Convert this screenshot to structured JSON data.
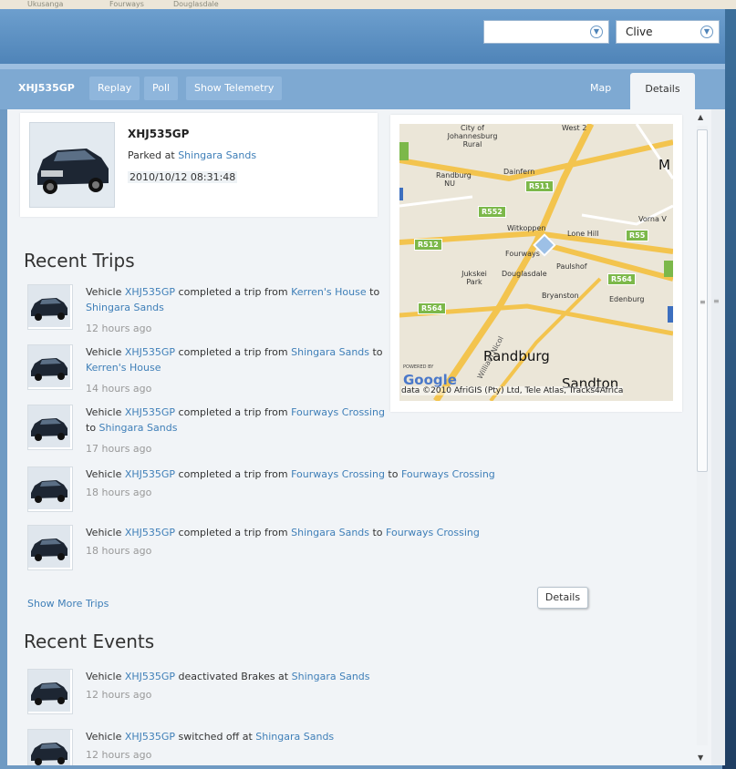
{
  "background": {
    "map_labels": [
      "Ukusanga",
      "Fourways",
      "Douglasdale"
    ]
  },
  "header": {
    "select_1": {
      "value": ""
    },
    "select_2": {
      "value": "Clive"
    }
  },
  "toolbar": {
    "vehicle_id": "XHJ535GP",
    "buttons": [
      "Replay",
      "Poll",
      "Show Telemetry"
    ],
    "tabs": [
      "Map",
      "Details"
    ],
    "active_tab": "Details"
  },
  "vehicle": {
    "id": "XHJ535GP",
    "status_prefix": "Parked at ",
    "location": "Shingara Sands",
    "timestamp": "2010/10/12 08:31:48"
  },
  "map": {
    "labels": [
      "City of Johannesburg Rural",
      "West 2",
      "Randburg NU",
      "Dainfern",
      "Witkoppen",
      "Lone Hill",
      "Vorna V",
      "Fourways",
      "Jukskei Park",
      "Douglasdale",
      "Paulshof",
      "Bryanston",
      "Edenburg",
      "M"
    ],
    "big_labels": [
      "Randburg",
      "Sandton"
    ],
    "shields": [
      "R511",
      "R552",
      "R512",
      "R564",
      "R564",
      "R55"
    ],
    "road_name": "William Nicol",
    "powered_by": "POWERED BY",
    "logo": "Google",
    "attribution": "data ©2010 AfriGIS (Pty) Ltd, Tele Atlas, Tracks4Africa"
  },
  "recent_trips": {
    "title": "Recent Trips",
    "items": [
      {
        "prefix": "Vehicle ",
        "vehicle": "XHJ535GP",
        "middle": " completed a trip from ",
        "from": "Kerren's House",
        "to_word": " to ",
        "to": "Shingara Sands",
        "time": "12 hours ago"
      },
      {
        "prefix": "Vehicle ",
        "vehicle": "XHJ535GP",
        "middle": " completed a trip from ",
        "from": "Shingara Sands",
        "to_word": " to ",
        "to": "Kerren's House",
        "time": "14 hours ago"
      },
      {
        "prefix": "Vehicle ",
        "vehicle": "XHJ535GP",
        "middle": " completed a trip from ",
        "from": "Fourways Crossing",
        "to_word": " to ",
        "to": "Shingara Sands",
        "time": "17 hours ago"
      },
      {
        "prefix": "Vehicle ",
        "vehicle": "XHJ535GP",
        "middle": " completed a trip from ",
        "from": "Fourways Crossing",
        "to_word": " to ",
        "to": "Fourways Crossing",
        "time": "18 hours ago"
      },
      {
        "prefix": "Vehicle ",
        "vehicle": "XHJ535GP",
        "middle": " completed a trip from ",
        "from": "Shingara Sands",
        "to_word": " to ",
        "to": "Fourways Crossing",
        "time": "18 hours ago"
      }
    ],
    "show_more": "Show More Trips"
  },
  "details_button": "Details",
  "recent_events": {
    "title": "Recent Events",
    "items": [
      {
        "prefix": "Vehicle ",
        "vehicle": "XHJ535GP",
        "action": " deactivated Brakes at ",
        "place": "Shingara Sands",
        "time": "12 hours ago"
      },
      {
        "prefix": "Vehicle ",
        "vehicle": "XHJ535GP",
        "action": " switched off at ",
        "place": "Shingara Sands",
        "time": "12 hours ago"
      }
    ]
  },
  "colors": {
    "link": "#3f7fb8",
    "header": "#4f84b8",
    "toolbar": "#7ea9d2"
  }
}
